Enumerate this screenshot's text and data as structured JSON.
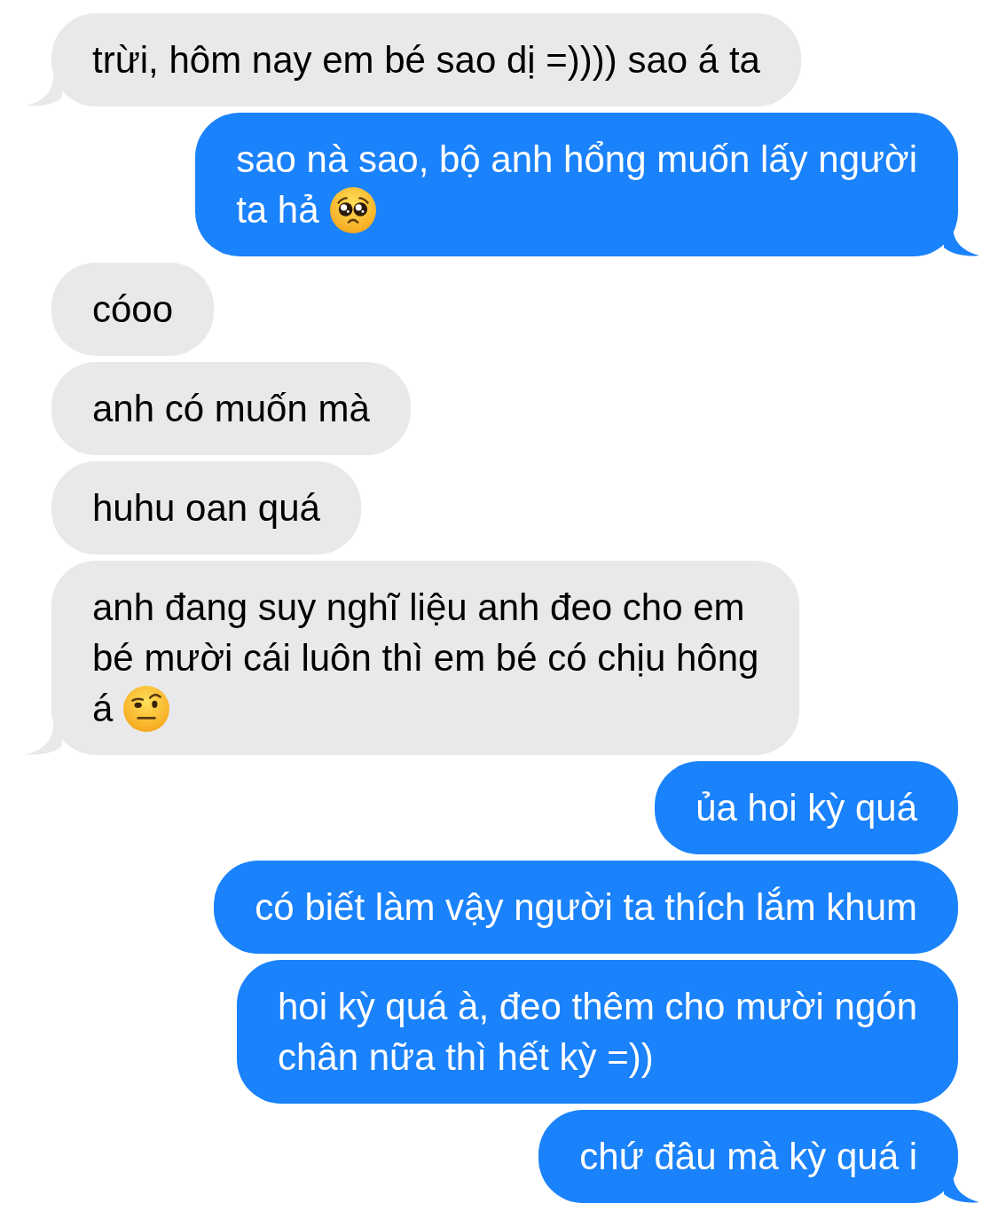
{
  "conversation": {
    "messages": [
      {
        "kind": "incoming",
        "lines": [
          "trừi, hôm nay em bé sao dị =)))) sao á ta"
        ],
        "tail": true
      },
      {
        "kind": "outgoing",
        "lines": [
          "sao nà sao, bộ anh hổng muốn lấy người",
          "ta hả"
        ],
        "emoji": {
          "kind": "pleading"
        },
        "tail": true
      },
      {
        "kind": "incoming",
        "lines": [
          "cóoo"
        ],
        "tail": false
      },
      {
        "kind": "incoming",
        "lines": [
          "anh có muốn mà"
        ],
        "tail": false
      },
      {
        "kind": "incoming",
        "lines": [
          "huhu oan quá"
        ],
        "tail": false
      },
      {
        "kind": "incoming",
        "lines": [
          "anh đang suy nghĩ liệu anh đeo cho em",
          "bé mười cái luôn thì em bé có chịu hông",
          "á"
        ],
        "emoji": {
          "kind": "raised-eyebrow"
        },
        "tail": true
      },
      {
        "kind": "outgoing",
        "lines": [
          "ủa hoi kỳ quá"
        ],
        "tail": false
      },
      {
        "kind": "outgoing",
        "lines": [
          "có biết làm vậy người ta thích lắm khum"
        ],
        "tail": false
      },
      {
        "kind": "outgoing",
        "lines": [
          "hoi kỳ quá à, đeo thêm cho mười ngón",
          "chân nữa thì hết kỳ =))"
        ],
        "tail": false
      },
      {
        "kind": "outgoing",
        "lines": [
          "chứ đâu mà kỳ quá i"
        ],
        "tail": true
      }
    ]
  }
}
